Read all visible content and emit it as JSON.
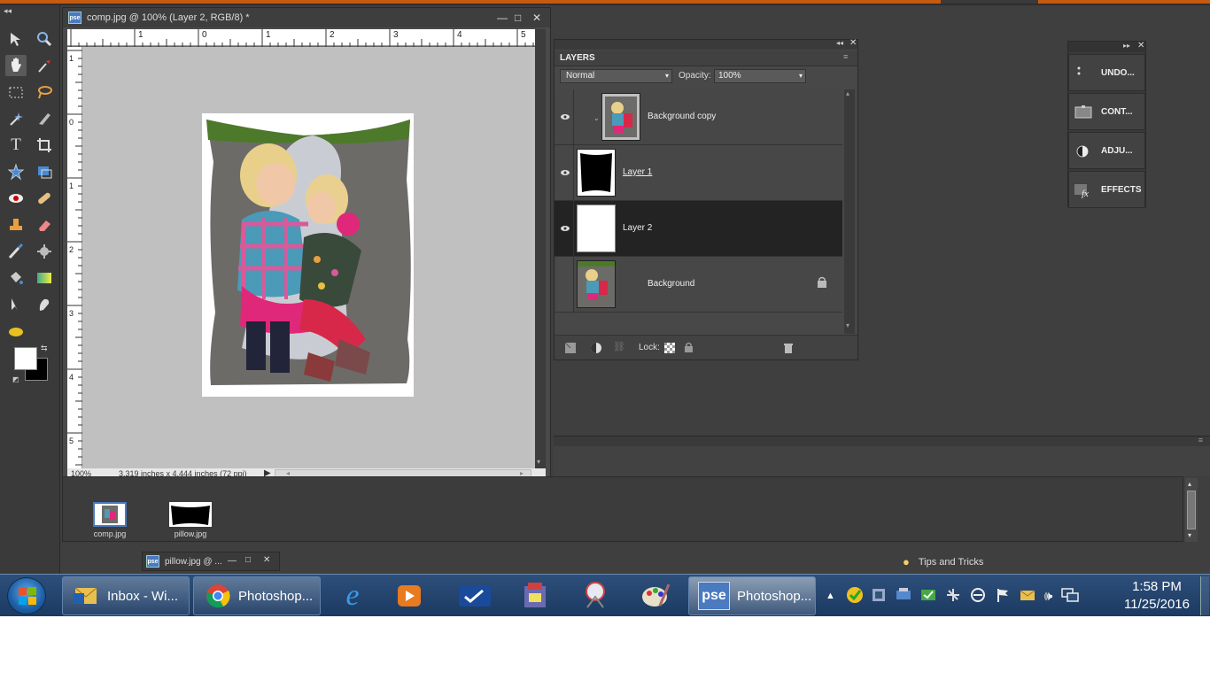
{
  "document": {
    "title": "comp.jpg @ 100% (Layer 2, RGB/8) *",
    "zoom": "100%",
    "size_info": "3.319 inches x 4.444 inches (72 ppi)",
    "ruler_h_labels": [
      "1",
      "0",
      "1",
      "2",
      "3",
      "4",
      "5"
    ],
    "ruler_v_labels": [
      "1",
      "0",
      "1",
      "2",
      "3",
      "4",
      "5"
    ]
  },
  "layers_panel": {
    "tab_label": "LAYERS",
    "blend_mode": "Normal",
    "opacity_label": "Opacity:",
    "opacity_value": "100%",
    "lock_label": "Lock:",
    "layers": [
      {
        "name": "Background copy",
        "visible": true,
        "selected": false,
        "locked": false
      },
      {
        "name": "Layer 1",
        "visible": true,
        "selected": false,
        "locked": false
      },
      {
        "name": "Layer 2",
        "visible": true,
        "selected": true,
        "locked": false
      },
      {
        "name": "Background",
        "visible": false,
        "selected": false,
        "locked": true
      }
    ]
  },
  "effects_panel": {
    "items": [
      {
        "label": "UNDO...",
        "icon": "undo-history-icon"
      },
      {
        "label": "CONT...",
        "icon": "content-icon"
      },
      {
        "label": "ADJU...",
        "icon": "adjustments-icon"
      },
      {
        "label": "EFFECTS",
        "icon": "effects-fx-icon"
      }
    ]
  },
  "project_bin": {
    "files": [
      {
        "name": "comp.jpg"
      },
      {
        "name": "pillow.jpg"
      }
    ],
    "minimized_doc": "pillow.jpg @ ..."
  },
  "tips": {
    "label": "Tips and Tricks"
  },
  "taskbar": {
    "buttons": [
      {
        "label": "Inbox - Wi...",
        "icon": "outlook-icon"
      },
      {
        "label": "Photoshop...",
        "icon": "chrome-icon"
      },
      {
        "label": "Photoshop...",
        "icon": "pse-icon"
      }
    ],
    "pinned_icons": [
      "internet-explorer-icon",
      "media-player-icon",
      "zoom-icon",
      "game-icon",
      "snipping-tool-icon",
      "paint-icon"
    ],
    "clock_time": "1:58 PM",
    "clock_date": "11/25/2016"
  },
  "colors": {
    "accent_orange": "#c55a11",
    "panel_dark": "#3f3f3f",
    "selected_layer": "#232323",
    "taskbar_blue": "#1c3a62"
  }
}
